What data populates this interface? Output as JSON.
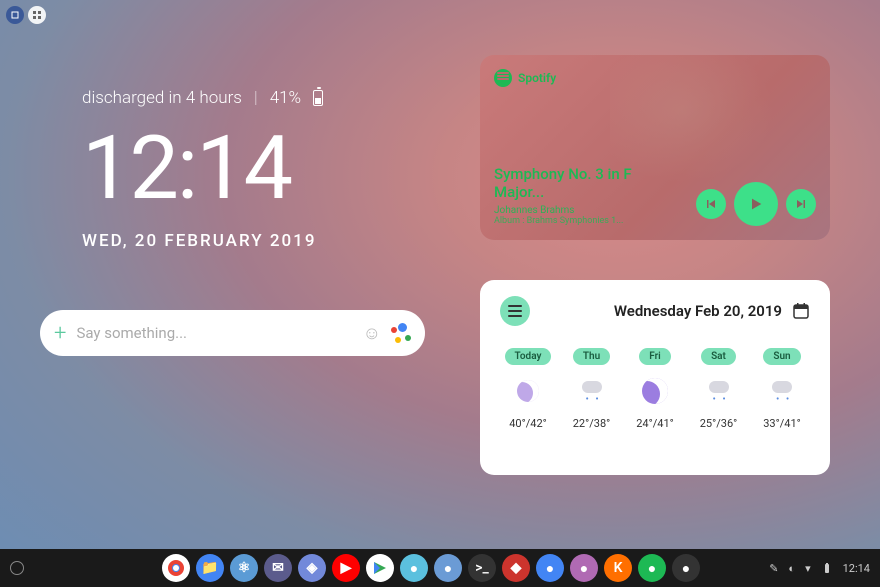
{
  "battery": {
    "status": "discharged in 4 hours",
    "percent": "41%"
  },
  "clock": {
    "time": "12:14",
    "date": "WED, 20 FEBRUARY 2019"
  },
  "search": {
    "placeholder": "Say something..."
  },
  "music": {
    "brand": "Spotify",
    "title": "Symphony No. 3 in F Major...",
    "artist": "Johannes Brahms",
    "album": "Album : Brahms Symphonies 1..."
  },
  "weather": {
    "date": "Wednesday Feb 20, 2019",
    "days": [
      {
        "label": "Today",
        "temp": "40°/42°",
        "icon": "moon-rain"
      },
      {
        "label": "Thu",
        "temp": "22°/38°",
        "icon": "cloud-rain"
      },
      {
        "label": "Fri",
        "temp": "24°/41°",
        "icon": "moon"
      },
      {
        "label": "Sat",
        "temp": "25°/36°",
        "icon": "cloud-rain"
      },
      {
        "label": "Sun",
        "temp": "33°/41°",
        "icon": "cloud-rain"
      }
    ]
  },
  "taskbar": {
    "time": "12:14",
    "apps": [
      {
        "name": "chrome",
        "color": "#fff"
      },
      {
        "name": "files",
        "color": "#4285f4"
      },
      {
        "name": "react",
        "color": "#5b9bd5"
      },
      {
        "name": "inbox",
        "color": "#5b5b8c"
      },
      {
        "name": "discord",
        "color": "#7289da"
      },
      {
        "name": "youtube",
        "color": "#ff0000"
      },
      {
        "name": "play",
        "color": "#fff"
      },
      {
        "name": "app1",
        "color": "#5bc0de"
      },
      {
        "name": "app2",
        "color": "#6b9bd5"
      },
      {
        "name": "terminal",
        "color": "#333"
      },
      {
        "name": "ruby",
        "color": "#cc342d"
      },
      {
        "name": "app3",
        "color": "#4285f4"
      },
      {
        "name": "app4",
        "color": "#b06ab3"
      },
      {
        "name": "kustom",
        "color": "#ff6f00"
      },
      {
        "name": "spotify",
        "color": "#1db954"
      },
      {
        "name": "app5",
        "color": "#333"
      }
    ]
  }
}
